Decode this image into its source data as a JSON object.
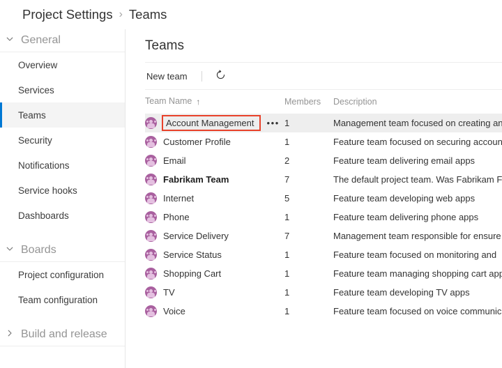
{
  "breadcrumb": {
    "root": "Project Settings",
    "separator": "›",
    "current": "Teams"
  },
  "sidebar": {
    "groups": [
      {
        "label": "General",
        "expanded": true,
        "chevron": "chevron-down-icon",
        "items": [
          {
            "label": "Overview",
            "selected": false
          },
          {
            "label": "Services",
            "selected": false
          },
          {
            "label": "Teams",
            "selected": true
          },
          {
            "label": "Security",
            "selected": false
          },
          {
            "label": "Notifications",
            "selected": false
          },
          {
            "label": "Service hooks",
            "selected": false
          },
          {
            "label": "Dashboards",
            "selected": false
          }
        ]
      },
      {
        "label": "Boards",
        "expanded": true,
        "chevron": "chevron-down-icon",
        "items": [
          {
            "label": "Project configuration",
            "selected": false
          },
          {
            "label": "Team configuration",
            "selected": false
          }
        ]
      },
      {
        "label": "Build and release",
        "expanded": false,
        "chevron": "chevron-right-icon",
        "items": []
      }
    ]
  },
  "main": {
    "title": "Teams",
    "toolbar": {
      "new_team_label": "New team",
      "refresh_icon": "refresh-icon",
      "refresh_title": "Refresh"
    },
    "table": {
      "columns": [
        {
          "key": "name",
          "label": "Team Name",
          "sort": "ascending",
          "sort_glyph": "↑"
        },
        {
          "key": "members",
          "label": "Members",
          "sort": null,
          "sort_glyph": ""
        },
        {
          "key": "description",
          "label": "Description",
          "sort": null,
          "sort_glyph": ""
        }
      ],
      "ellipsis_label": "•••",
      "rows": [
        {
          "name": "Account Management",
          "members": "1",
          "description": "Management team focused on creating an",
          "default_team": false,
          "highlighted": true,
          "outlined": true,
          "show_ellipsis": true,
          "avatar": "team-avatar-icon"
        },
        {
          "name": "Customer Profile",
          "members": "1",
          "description": "Feature team focused on securing accoun",
          "default_team": false,
          "highlighted": false,
          "outlined": false,
          "show_ellipsis": false,
          "avatar": "team-avatar-icon"
        },
        {
          "name": "Email",
          "members": "2",
          "description": "Feature team delivering email apps",
          "default_team": false,
          "highlighted": false,
          "outlined": false,
          "show_ellipsis": false,
          "avatar": "team-avatar-icon"
        },
        {
          "name": "Fabrikam Team",
          "members": "7",
          "description": "The default project team. Was Fabrikam Fi",
          "default_team": true,
          "highlighted": false,
          "outlined": false,
          "show_ellipsis": false,
          "avatar": "team-avatar-icon"
        },
        {
          "name": "Internet",
          "members": "5",
          "description": "Feature team developing web apps",
          "default_team": false,
          "highlighted": false,
          "outlined": false,
          "show_ellipsis": false,
          "avatar": "team-avatar-icon"
        },
        {
          "name": "Phone",
          "members": "1",
          "description": "Feature team delivering phone apps",
          "default_team": false,
          "highlighted": false,
          "outlined": false,
          "show_ellipsis": false,
          "avatar": "team-avatar-icon"
        },
        {
          "name": "Service Delivery",
          "members": "7",
          "description": "Management team responsible for ensure",
          "default_team": false,
          "highlighted": false,
          "outlined": false,
          "show_ellipsis": false,
          "avatar": "team-avatar-icon"
        },
        {
          "name": "Service Status",
          "members": "1",
          "description": "Feature team focused on monitoring and ",
          "default_team": false,
          "highlighted": false,
          "outlined": false,
          "show_ellipsis": false,
          "avatar": "team-avatar-icon"
        },
        {
          "name": "Shopping Cart",
          "members": "1",
          "description": "Feature team managing shopping cart app",
          "default_team": false,
          "highlighted": false,
          "outlined": false,
          "show_ellipsis": false,
          "avatar": "team-avatar-icon"
        },
        {
          "name": "TV",
          "members": "1",
          "description": "Feature team developing TV apps",
          "default_team": false,
          "highlighted": false,
          "outlined": false,
          "show_ellipsis": false,
          "avatar": "team-avatar-icon"
        },
        {
          "name": "Voice",
          "members": "1",
          "description": "Feature team focused on voice communic",
          "default_team": false,
          "highlighted": false,
          "outlined": false,
          "show_ellipsis": false,
          "avatar": "team-avatar-icon"
        }
      ]
    }
  },
  "colors": {
    "accent": "#0078d4",
    "highlight_outline": "#e8412a",
    "avatar": "#a9609f",
    "row_selected_bg": "#eeeeee",
    "nav_selected_bg": "#f4f4f4",
    "muted_text": "#949494"
  }
}
